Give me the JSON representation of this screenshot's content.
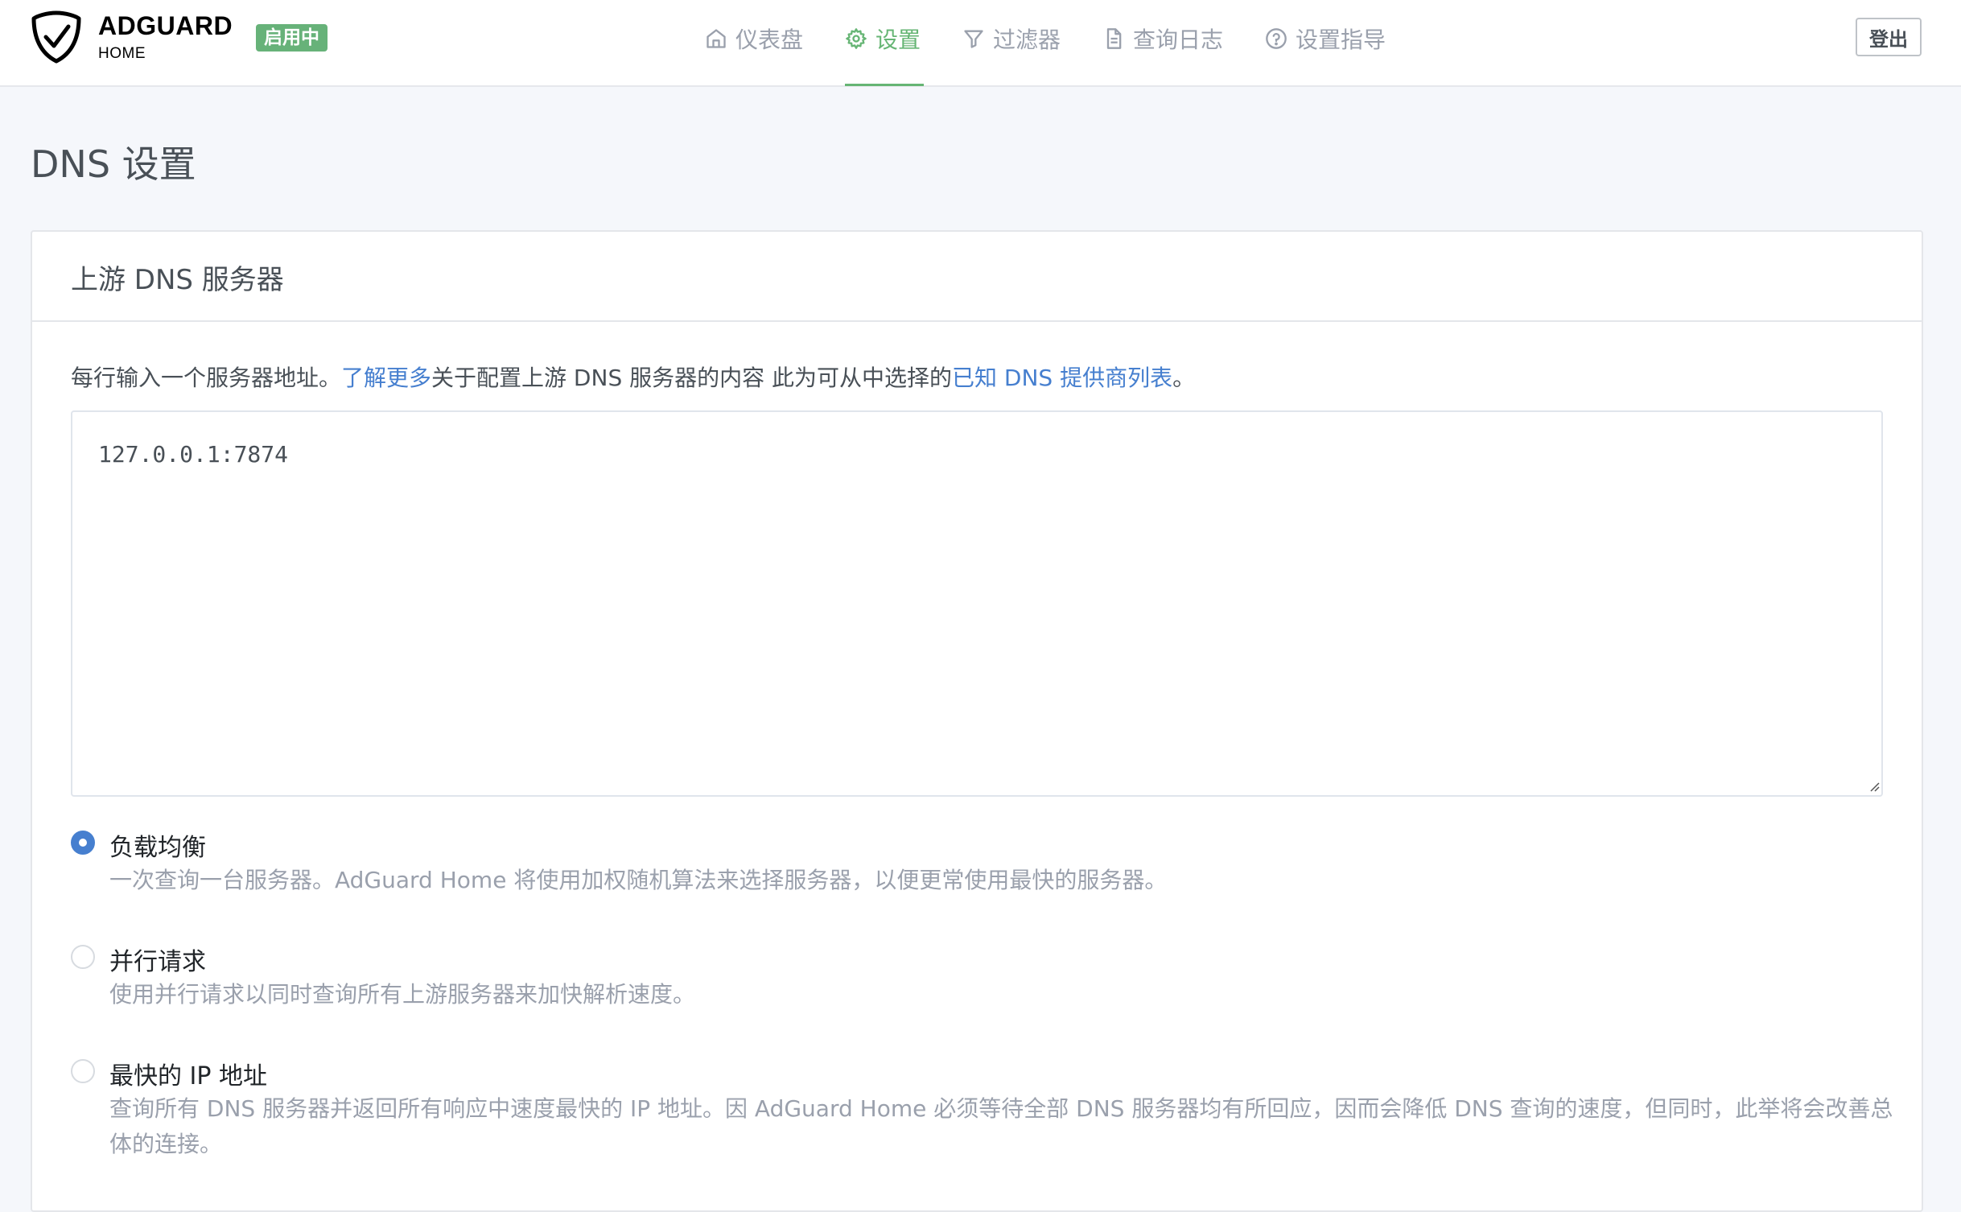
{
  "brand": {
    "title": "ADGUARD",
    "subtitle": "HOME",
    "status_badge": "启用中",
    "accent": "#66b574"
  },
  "nav": {
    "dashboard": "仪表盘",
    "settings": "设置",
    "filters": "过滤器",
    "query_log": "查询日志",
    "setup_guide": "设置指导",
    "active": "settings"
  },
  "header": {
    "logout_label": "登出"
  },
  "page": {
    "title": "DNS 设置"
  },
  "upstream": {
    "card_title": "上游 DNS 服务器",
    "desc_prefix": "每行输入一个服务器地址。",
    "desc_link1": "了解更多",
    "desc_middle": "关于配置上游 DNS 服务器的内容 此为可从中选择的",
    "desc_link2": "已知 DNS 提供商列表",
    "desc_suffix": "。",
    "servers_value": "127.0.0.1:7874",
    "link_color": "#467fcf"
  },
  "modes": {
    "selected": "load_balance",
    "options": [
      {
        "id": "load_balance",
        "label": "负载均衡",
        "description": "一次查询一台服务器。AdGuard Home 将使用加权随机算法来选择服务器，以便更常使用最快的服务器。"
      },
      {
        "id": "parallel",
        "label": "并行请求",
        "description": "使用并行请求以同时查询所有上游服务器来加快解析速度。"
      },
      {
        "id": "fastest_addr",
        "label": "最快的 IP 地址",
        "description": "查询所有 DNS 服务器并返回所有响应中速度最快的 IP 地址。因 AdGuard Home 必须等待全部 DNS 服务器均有所回应，因而会降低 DNS 查询的速度，但同时，此举将会改善总体的连接。"
      }
    ]
  }
}
